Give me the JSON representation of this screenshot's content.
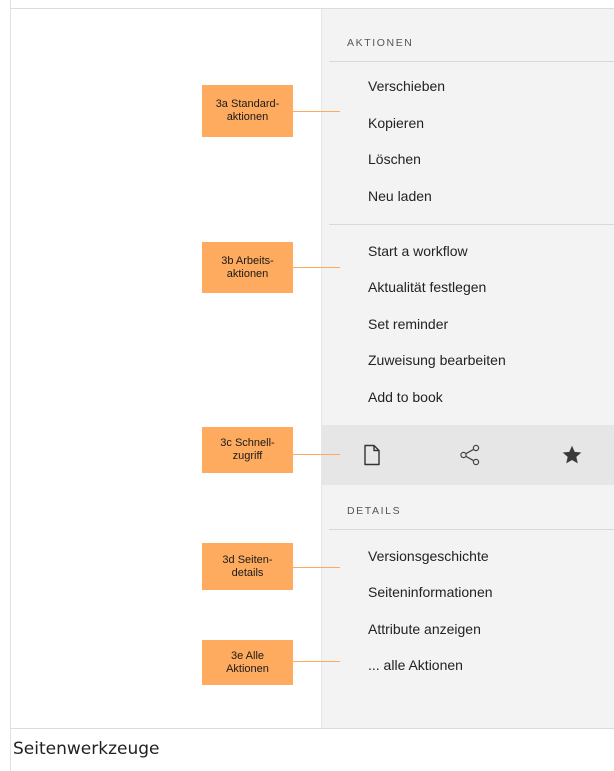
{
  "sections": {
    "actions_heading": "AKTIONEN",
    "details_heading": "DETAILS"
  },
  "standard_actions": [
    "Verschieben",
    "Kopieren",
    "Löschen",
    "Neu laden"
  ],
  "work_actions": [
    "Start a workflow",
    "Aktualität festlegen",
    "Set reminder",
    "Zuweisung bearbeiten",
    "Add to book"
  ],
  "quick_access_icons": [
    "page-icon",
    "share-icon",
    "star-icon"
  ],
  "details_items": [
    "Versionsgeschichte",
    "Seiteninformationen",
    "Attribute anzeigen",
    "... alle Aktionen"
  ],
  "callouts": {
    "a": "3a Standard-\naktionen",
    "b": "3b Arbeits-\naktionen",
    "c": "3c Schnell-\nzugriff",
    "d": "3d  Seiten-\ndetails",
    "e": "3e Alle\nAktionen"
  },
  "caption": "Seitenwerkzeuge",
  "colors": {
    "panel": "#f3f3f3",
    "quick_bar": "#e6e6e6",
    "callout": "#ffab5f"
  }
}
